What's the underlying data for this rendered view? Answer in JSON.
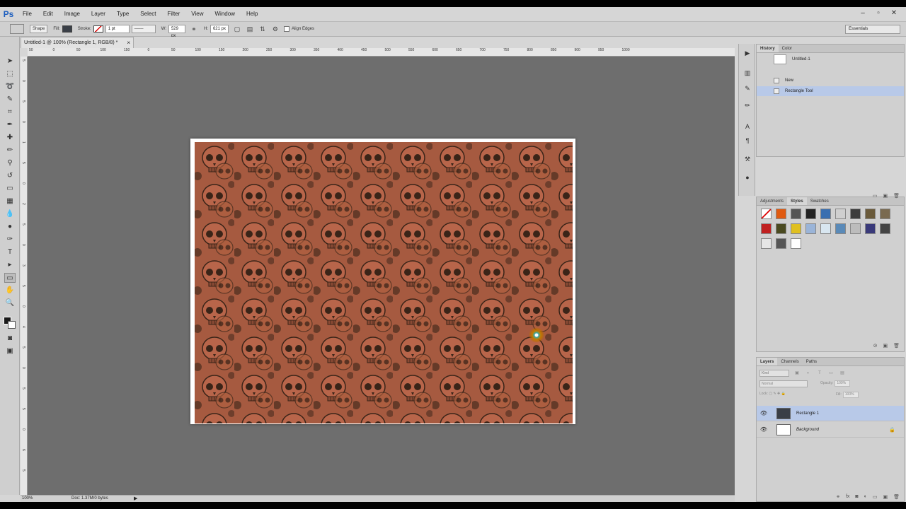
{
  "app": {
    "logo": "Ps",
    "menu": [
      "File",
      "Edit",
      "Image",
      "Layer",
      "Type",
      "Select",
      "Filter",
      "View",
      "Window",
      "Help"
    ],
    "window_controls": [
      "–",
      "▫",
      "✕"
    ]
  },
  "options": {
    "mode": "Shape",
    "fill_label": "Fill:",
    "stroke_label": "Stroke:",
    "stroke_width": "1 pt",
    "w_label": "W:",
    "w_value": "529 px",
    "h_label": "H:",
    "h_value": "621 px",
    "align_edges": "Align Edges",
    "workspace": "Essentials"
  },
  "document": {
    "tab_title": "Untitled-1 @ 100% (Rectangle 1, RGB/8) *",
    "ruler_h": [
      "50",
      "0",
      "50",
      "100",
      "150",
      "0",
      "50",
      "100",
      "150",
      "200",
      "250",
      "300",
      "350",
      "400",
      "450",
      "500",
      "550",
      "600",
      "650",
      "700",
      "750",
      "800",
      "850",
      "900",
      "950",
      "1000"
    ],
    "ruler_v": [
      "5",
      "0",
      "5",
      "0",
      "1",
      "5",
      "0",
      "2",
      "5",
      "0",
      "3",
      "5",
      "0",
      "4",
      "5",
      "0",
      "5",
      "5",
      "0",
      "6",
      "5"
    ]
  },
  "status": {
    "zoom": "100%",
    "doc_info": "Doc: 1.37M/0 bytes"
  },
  "history": {
    "tabs": [
      "History",
      "Color"
    ],
    "snapshot": "Untitled-1",
    "items": [
      {
        "name": "New",
        "selected": false
      },
      {
        "name": "Rectangle Tool",
        "selected": true
      }
    ]
  },
  "styles": {
    "tabs": [
      "Adjustments",
      "Styles",
      "Swatches"
    ],
    "swatches": [
      "#ffffff",
      "#e05a10",
      "#555555",
      "#222222",
      "#3a6fb0",
      "#cfcfcf",
      "#3c3c3c",
      "#6a5a3a",
      "#7a6a50",
      "#c02020",
      "#4a4a20",
      "#e0c020",
      "#9ab4d8",
      "#d8e6f0",
      "#5a8ab8",
      "#bcbcbc",
      "#3a3a7a",
      "#444444",
      "#e6e6e6",
      "#555555",
      "#ffffff"
    ]
  },
  "layers": {
    "tabs": [
      "Layers",
      "Channels",
      "Paths"
    ],
    "filter_kind": "Kind",
    "blend_mode": "Normal",
    "opacity_label": "Opacity:",
    "opacity_value": "100%",
    "lock_label": "Lock:",
    "fill_label": "Fill:",
    "fill_value": "100%",
    "items": [
      {
        "name": "Rectangle 1",
        "selected": true,
        "thumb_color": "#3a3f47"
      },
      {
        "name": "Background",
        "selected": false,
        "thumb_color": "#ffffff"
      }
    ]
  },
  "colors": {
    "skull_base": "#a6543e",
    "selection": "#b8c9e8",
    "canvas_bg": "#6e6e6e"
  }
}
